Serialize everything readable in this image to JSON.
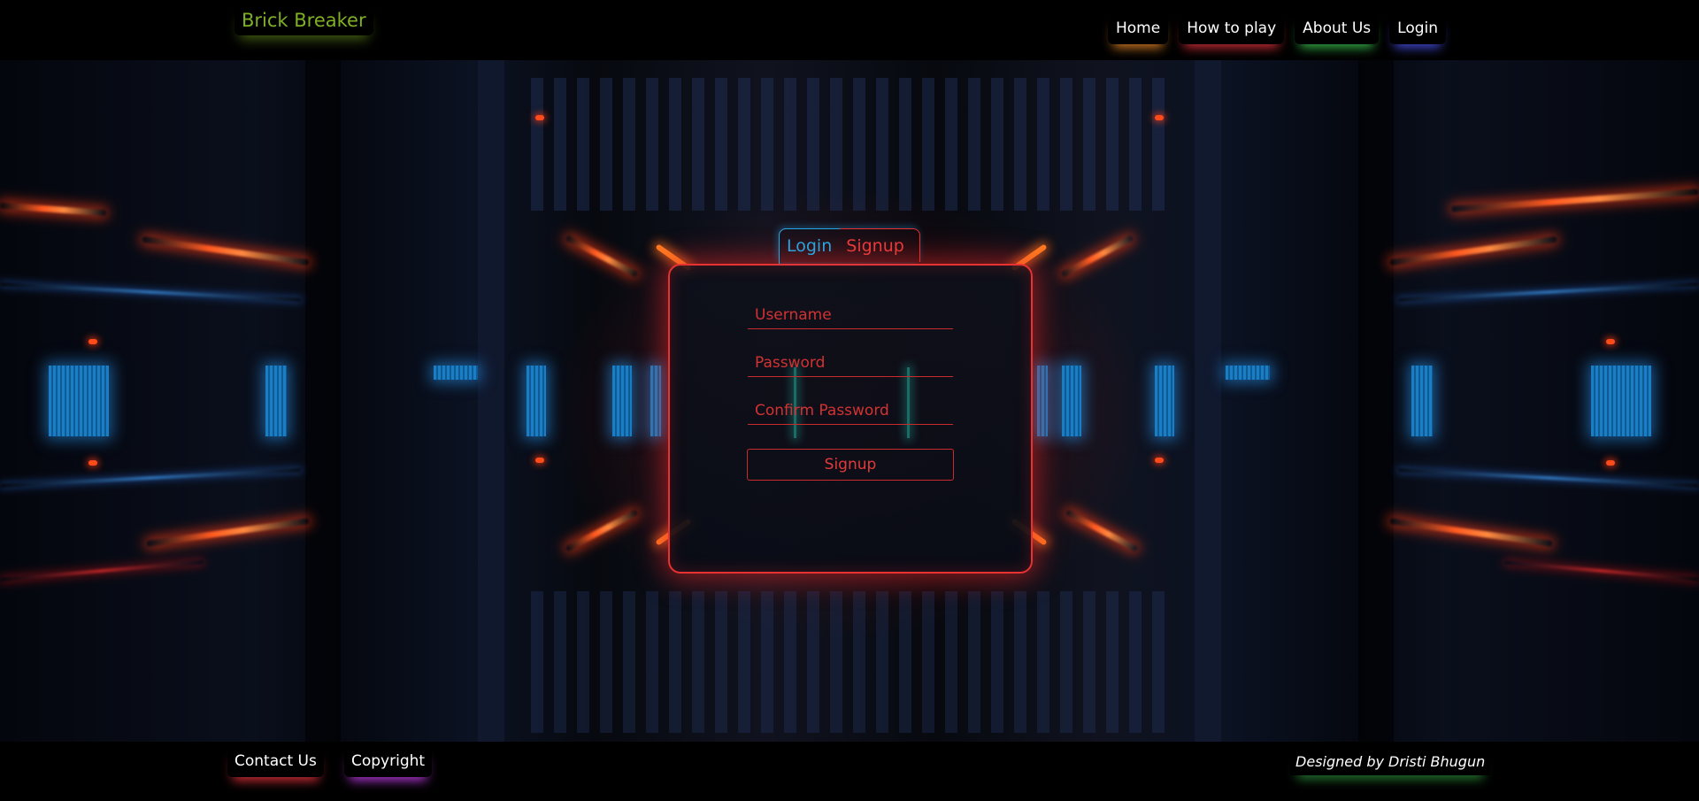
{
  "brand": {
    "title": "Brick Breaker"
  },
  "nav": {
    "items": [
      {
        "label": "Home"
      },
      {
        "label": "How to play"
      },
      {
        "label": "About Us"
      },
      {
        "label": "Login"
      }
    ]
  },
  "auth": {
    "tabs": [
      {
        "label": "Login"
      },
      {
        "label": "Signup"
      }
    ],
    "active_tab": "Signup",
    "fields": {
      "username": {
        "placeholder": "Username",
        "value": ""
      },
      "password": {
        "placeholder": "Password",
        "value": ""
      },
      "confirm_password": {
        "placeholder": "Confirm Password",
        "value": ""
      }
    },
    "submit_label": "Signup"
  },
  "footer": {
    "links": [
      {
        "label": "Contact Us"
      },
      {
        "label": "Copyright"
      }
    ],
    "credit": "Designed by Dristi Bhugun"
  },
  "colors": {
    "brand": "#7fb024",
    "accent_red": "#e83232",
    "accent_blue": "#2aa3df",
    "background": "#000000"
  }
}
